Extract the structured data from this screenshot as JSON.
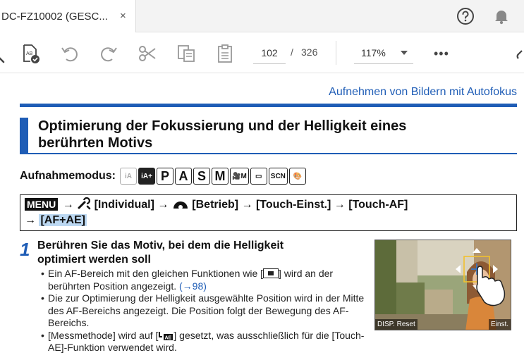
{
  "tab": {
    "title": "DC-FZ10002 (GESC...",
    "close": "×"
  },
  "icons": {
    "help": "help-icon",
    "bell": "bell-icon",
    "search": "search-icon",
    "check_doc": "document-check-icon",
    "undo": "undo-icon",
    "redo": "redo-icon",
    "cut": "scissors-icon",
    "copy": "copy-icon",
    "paste": "clipboard-icon",
    "more": "more-icon",
    "link": "link-icon"
  },
  "toolbar": {
    "page_current": "102",
    "page_separator": "/",
    "page_total": "326",
    "zoom": "117%",
    "more": "•••"
  },
  "doc": {
    "section_link": "Aufnehmen von Bildern mit Autofokus",
    "heading_line1": "Optimierung der Fokussierung und der Helligkeit eines",
    "heading_line2": "berührten Motivs",
    "mode_label": "Aufnahmemodus:",
    "modes": [
      "iA",
      "iA+",
      "P",
      "A",
      "S",
      "M",
      "🎥M",
      "▭",
      "SCN",
      "🎨"
    ],
    "menu": {
      "badge": "MENU",
      "arrow": "→",
      "item1": "[Individual]",
      "item2": "[Betrieb]",
      "item3": "[Touch-Einst.]",
      "item4": "[Touch-AF]",
      "item5": "[AF+AE]"
    },
    "step": {
      "number": "1",
      "title": "Berühren Sie das Motiv, bei dem die Helligkeit optimiert werden soll",
      "b1_a": "Ein AF-Bereich mit den gleichen Funktionen wie [",
      "b1_b": "] wird an der berührten Position angezeigt.",
      "b1_ref": "(→98)",
      "b2": "Die zur Optimierung der Helligkeit ausgewählte Position wird in der Mitte des AF-Bereichs angezeigt. Die Position folgt der Bewegung des AF-Bereichs.",
      "b3_a": "[Messmethode] wird auf [",
      "b3_b": "] gesetzt, was ausschließlich für die [Touch-AE]-Funktion verwendet wird."
    },
    "photo": {
      "left_label": "DISP. Reset",
      "right_label": "Einst."
    }
  }
}
